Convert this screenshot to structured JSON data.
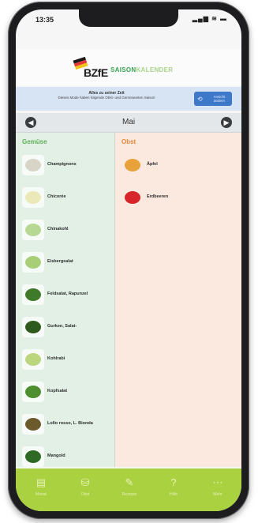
{
  "status": {
    "time": "13:35",
    "indicators": "▂▄▆ ≋ ▬"
  },
  "header": {
    "logo_text": "BZfE",
    "title_part1": "SAISON",
    "title_part2": "KALENDER",
    "flag_colors": [
      "#1a1a1a",
      "#e53935",
      "#f2c418"
    ]
  },
  "banner": {
    "line1": "Alles zu seiner Zeit",
    "line2": "Dieses Mode haben folgende Obst- und Gemüsearten Saison",
    "button_icon": "⟲",
    "button_label": "Ansicht ändern"
  },
  "month_nav": {
    "prev_icon": "◀",
    "next_icon": "▶",
    "month": "Mai"
  },
  "vegetables": {
    "heading": "Gemüse",
    "items": [
      {
        "label": "Champignons",
        "color": "#d8d5c8"
      },
      {
        "label": "Chicorée",
        "color": "#ece9b8"
      },
      {
        "label": "Chinakohl",
        "color": "#b7d893"
      },
      {
        "label": "Eisbergsalat",
        "color": "#a8cf78"
      },
      {
        "label": "Feldsalat, Rapunzel",
        "color": "#3f7a2b"
      },
      {
        "label": "Gurken, Salat-",
        "color": "#2f5a1e"
      },
      {
        "label": "Kohlrabi",
        "color": "#bcd67e"
      },
      {
        "label": "Kopfsalat",
        "color": "#4d8f2f"
      },
      {
        "label": "Lollo rosso, L. Bionda",
        "color": "#6b5a2c"
      },
      {
        "label": "Mangold",
        "color": "#2e6a24"
      }
    ]
  },
  "fruits": {
    "heading": "Obst",
    "items": [
      {
        "label": "Äpfel",
        "color": "#e7a33a"
      },
      {
        "label": "Erdbeeren",
        "color": "#d8242b"
      }
    ]
  },
  "tabbar": {
    "items": [
      {
        "icon": "▤",
        "label": "Monat"
      },
      {
        "icon": "⛁",
        "label": "Obst"
      },
      {
        "icon": "✎",
        "label": "Rezepte"
      },
      {
        "icon": "?",
        "label": "Hilfe"
      },
      {
        "icon": "⋯",
        "label": "Mehr"
      }
    ]
  }
}
